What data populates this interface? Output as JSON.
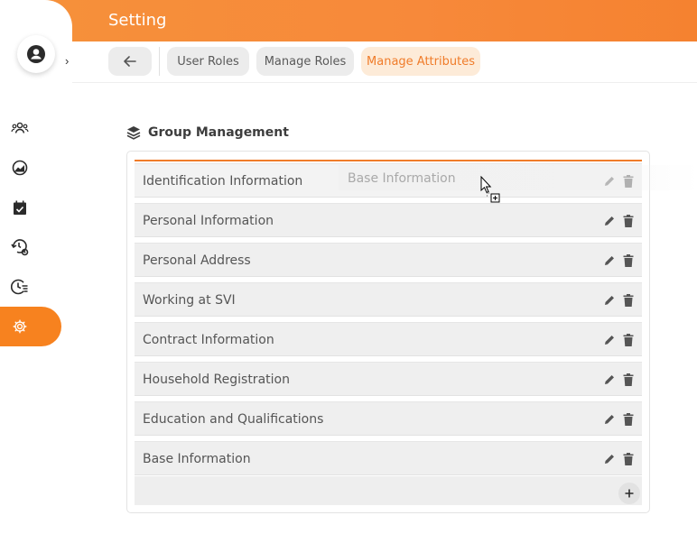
{
  "header": {
    "title": "Setting"
  },
  "tabs": [
    {
      "label": "User Roles",
      "active": false
    },
    {
      "label": "Manage Roles",
      "active": false
    },
    {
      "label": "Manage Attributes",
      "active": true
    }
  ],
  "sidebar": {
    "items": [
      {
        "icon": "users-icon"
      },
      {
        "icon": "chart-pie-icon"
      },
      {
        "icon": "calendar-check-icon"
      },
      {
        "icon": "history-gear-icon"
      },
      {
        "icon": "clock-list-icon"
      },
      {
        "icon": "gear-icon",
        "active": true
      }
    ]
  },
  "section": {
    "title": "Group Management"
  },
  "groups": [
    {
      "label": "Identification Information"
    },
    {
      "label": "Personal Information"
    },
    {
      "label": "Personal Address"
    },
    {
      "label": "Working at SVI"
    },
    {
      "label": "Contract Information"
    },
    {
      "label": "Household Registration"
    },
    {
      "label": "Education and Qualifications"
    },
    {
      "label": "Base Information"
    }
  ],
  "drag_ghost": {
    "label": "Base Information"
  },
  "colors": {
    "accent": "#f7821f",
    "active_tab_bg": "#fdebd8"
  }
}
